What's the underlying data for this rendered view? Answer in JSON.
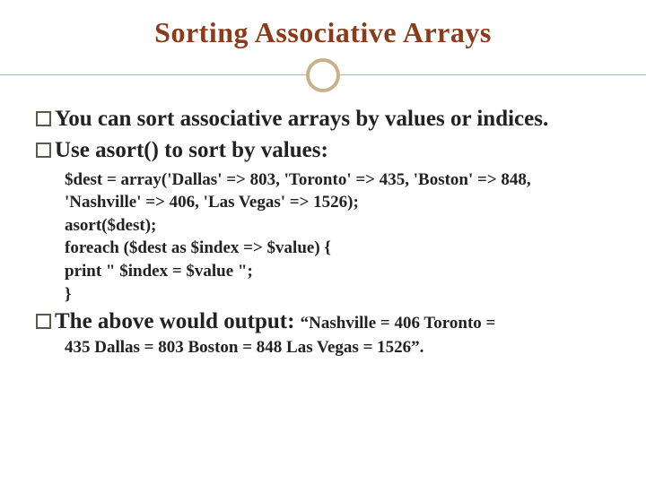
{
  "title": "Sorting Associative Arrays",
  "bullets": {
    "b1": "You can sort associative arrays by values or indices.",
    "b2": "Use asort() to sort by values:",
    "b3_lead": "The above would output: ",
    "b3_tail_a": "“Nashville = 406 Toronto =",
    "b3_tail_b": "435 Dallas = 803 Boston = 848 Las Vegas = 1526”."
  },
  "code": {
    "l1": "$dest = array('Dallas' => 803, 'Toronto' => 435, 'Boston' => 848,",
    "l2": "'Nashville' => 406, 'Las Vegas' => 1526);",
    "l3": "asort($dest);",
    "l4": "foreach ($dest as $index => $value) {",
    "l5": "print \" $index = $value \";",
    "l6": "}"
  }
}
